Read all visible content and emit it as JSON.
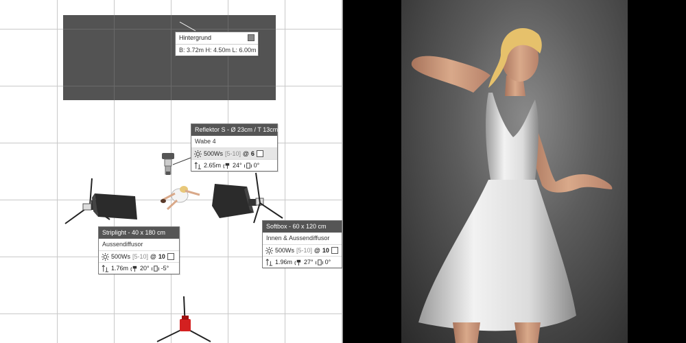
{
  "backdrop_panel": {
    "title": "Hintergrund",
    "dims": "B: 3.72m H: 4.50m L: 6.00m"
  },
  "reflektor_panel": {
    "title": "Reflektor S - Ø 23cm / T 13cm",
    "modifier": "Wabe 4",
    "power": "500Ws",
    "range": "[5-10]",
    "setting_prefix": "@",
    "setting": "6",
    "height": "2.65m",
    "tilt": "24°",
    "rotation": "0°"
  },
  "striplight_panel": {
    "title": "Striplight - 40 x 180 cm",
    "modifier": "Aussendiffusor",
    "power": "500Ws",
    "range": "[5-10]",
    "setting_prefix": "@",
    "setting": "10",
    "height": "1.76m",
    "tilt": "20°",
    "rotation": "-5°"
  },
  "softbox_panel": {
    "title": "Softbox - 60 x 120 cm",
    "modifier": "Innen & Aussendiffusor",
    "power": "500Ws",
    "range": "[5-10]",
    "setting_prefix": "@",
    "setting": "10",
    "height": "1.96m",
    "tilt": "27°",
    "rotation": "0°"
  },
  "colors": {
    "backdrop": "#535353",
    "panel_header": "#555555",
    "grid": "#c8c8c8",
    "camera_red": "#d42020"
  },
  "icons": [
    "flash-power-icon",
    "light-height-icon",
    "light-tilt-icon",
    "light-rotation-icon",
    "checkbox-icon"
  ]
}
